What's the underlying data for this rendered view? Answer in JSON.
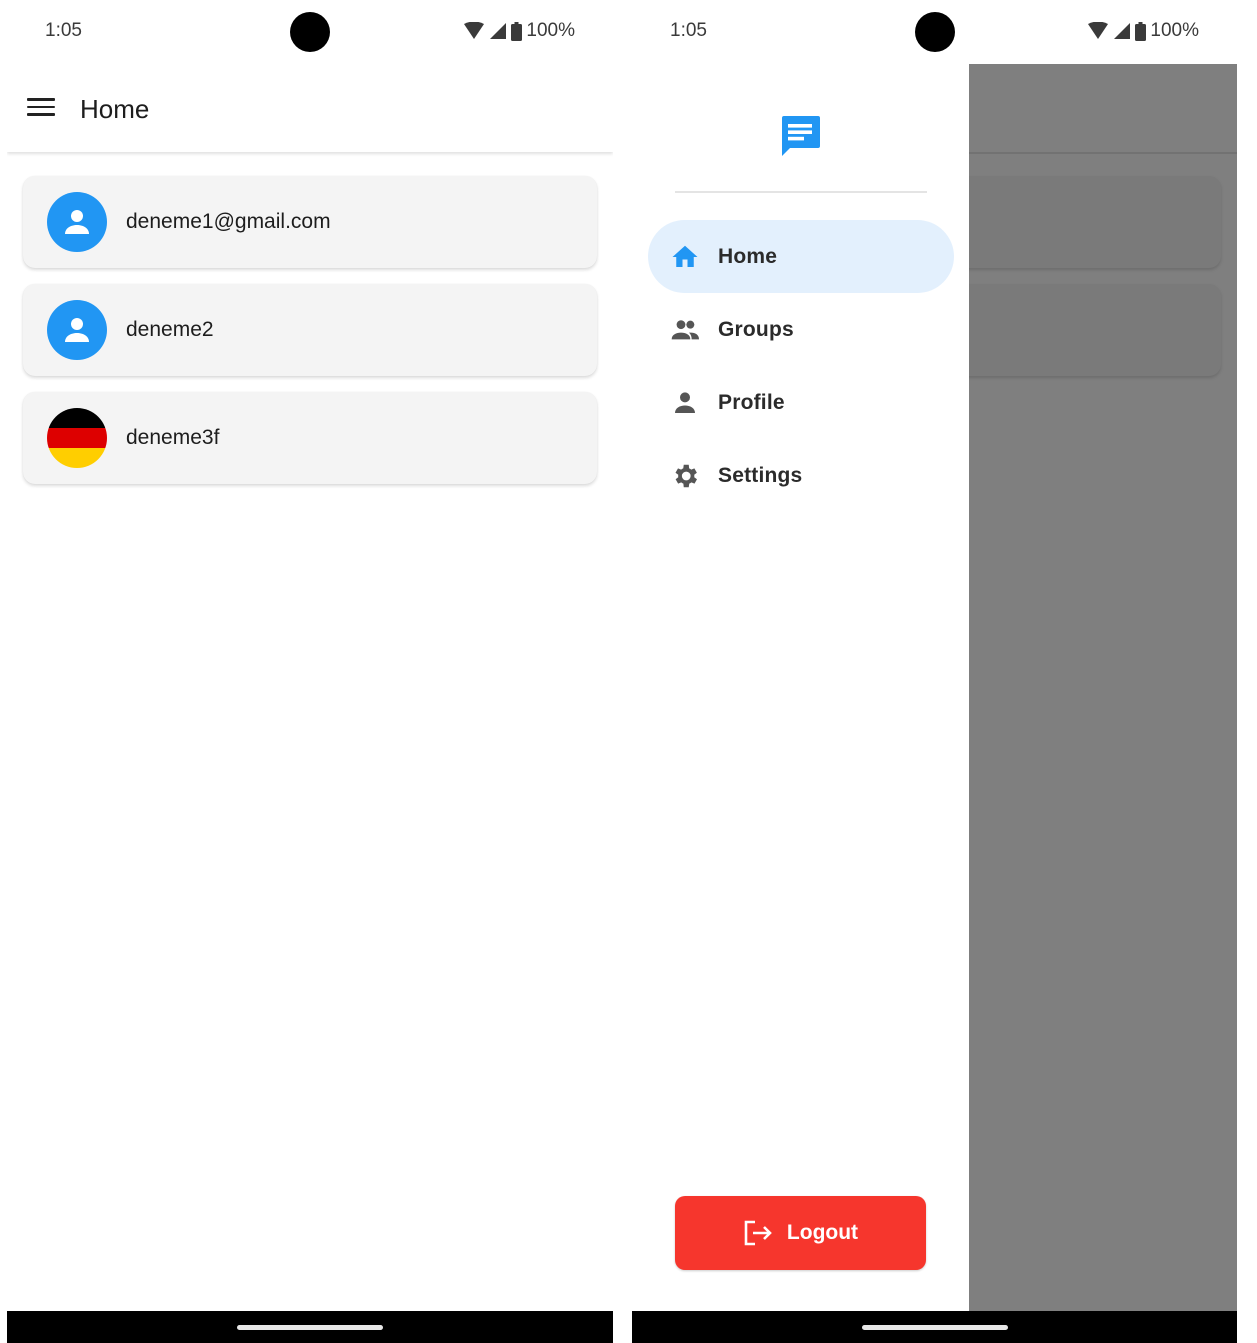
{
  "status_bar": {
    "time": "1:05",
    "battery": "100%"
  },
  "home_screen": {
    "title": "Home",
    "users": [
      {
        "name": "deneme1@gmail.com",
        "avatar": "person-icon"
      },
      {
        "name": "deneme2",
        "avatar": "person-icon"
      },
      {
        "name": "deneme3f",
        "avatar": "germany-flag-icon"
      }
    ]
  },
  "drawer": {
    "logo": "chat-icon",
    "items": [
      {
        "label": "Home",
        "icon": "home-icon",
        "active": true
      },
      {
        "label": "Groups",
        "icon": "groups-icon",
        "active": false
      },
      {
        "label": "Profile",
        "icon": "person-icon",
        "active": false
      },
      {
        "label": "Settings",
        "icon": "gear-icon",
        "active": false
      }
    ],
    "logout_label": "Logout"
  },
  "colors": {
    "accent": "#2196f3",
    "active_item_bg": "#e3f0fd",
    "logout": "#f6362d",
    "scrim": "#7f7f7f"
  }
}
